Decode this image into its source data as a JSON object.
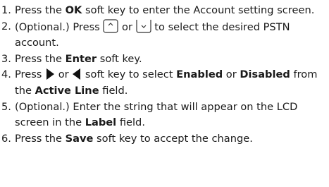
{
  "steps": [
    {
      "number": "1.",
      "parts": [
        "Press the ",
        "OK",
        " soft key to enter the Account setting screen."
      ]
    },
    {
      "number": "2.",
      "parts": [
        "(Optional.) Press ",
        " or ",
        " to select the desired PSTN account."
      ],
      "icons": [
        "navigation-up-key-icon",
        "navigation-down-key-icon"
      ]
    },
    {
      "number": "3.",
      "parts": [
        "Press the ",
        "Enter",
        " soft key."
      ]
    },
    {
      "number": "4.",
      "parts": [
        "Press ",
        " or ",
        " soft key to select ",
        "Enabled",
        " or ",
        "Disabled",
        " from the ",
        "Active Line",
        " field."
      ],
      "icons": [
        "right-arrow-icon",
        "left-arrow-icon"
      ]
    },
    {
      "number": "5.",
      "parts": [
        "(Optional.) Enter the string that will appear on the LCD screen in the ",
        "Label",
        " field."
      ]
    },
    {
      "number": "6.",
      "parts": [
        "Press the ",
        "Save",
        " soft key to accept the change."
      ]
    }
  ]
}
